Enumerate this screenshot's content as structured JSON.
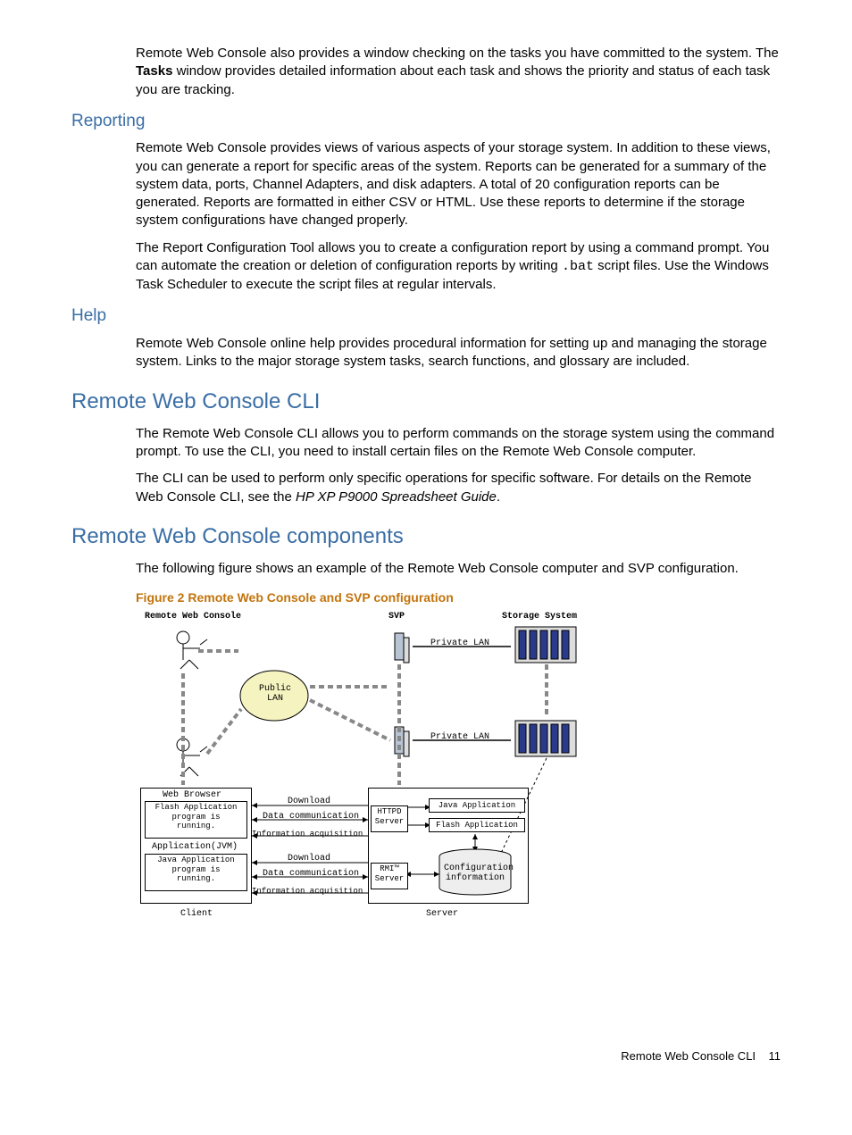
{
  "intro": {
    "p1a": "Remote Web Console also provides a window checking on the tasks you have committed to the system. The ",
    "p1b": "Tasks",
    "p1c": " window provides detailed information about each task and shows the priority and status of each task you are tracking."
  },
  "reporting": {
    "title": "Reporting",
    "p1": "Remote Web Console provides views of various aspects of your storage system. In addition to these views, you can generate a report for specific areas of the system. Reports can be generated for a summary of the system data, ports, Channel Adapters, and disk adapters. A total of 20 configuration reports can be generated. Reports are formatted in either CSV or HTML. Use these reports to determine if the storage system configurations have changed properly.",
    "p2a": "The Report Configuration Tool allows you to create a configuration report by using a command prompt. You can automate the creation or deletion of configuration reports by writing ",
    "p2b": ".bat",
    "p2c": " script files. Use the Windows Task Scheduler to execute the script files at regular intervals."
  },
  "help": {
    "title": "Help",
    "p1": "Remote Web Console online help provides procedural information for setting up and managing the storage system. Links to the major storage system tasks, search functions, and glossary are included."
  },
  "cli": {
    "title": "Remote Web Console CLI",
    "p1": "The Remote Web Console CLI allows you to perform commands on the storage system using the command prompt. To use the CLI, you need to install certain files on the Remote Web Console computer.",
    "p2a": "The CLI can be used to perform only specific operations for specific software. For details on the Remote Web Console CLI, see the ",
    "p2b": "HP XP P9000 Spreadsheet Guide",
    "p2c": "."
  },
  "components": {
    "title": "Remote Web Console components",
    "p1": "The following figure shows an example of the Remote Web Console computer and SVP configuration.",
    "figcap": "Figure 2 Remote Web Console and SVP configuration"
  },
  "diagram": {
    "rwc": "Remote Web Console",
    "svp": "SVP",
    "storage": "Storage System",
    "publiclan": "Public\nLAN",
    "privatelan": "Private LAN",
    "webbrowser": "Web Browser",
    "flashapp": "Flash Application program is running.",
    "appjvm": "Application(JVM)",
    "javaapp": "Java Application program is running.",
    "download": "Download",
    "datacomm": "Data communication",
    "infoacq": "Information acquisition",
    "httpd": "HTTPD Server",
    "rmi": "RMI™ Server",
    "javaappbox": "Java Application",
    "flashappbox": "Flash Application",
    "configinfo": "Configuration information",
    "client": "Client",
    "server": "Server"
  },
  "footer": {
    "text": "Remote Web Console CLI",
    "page": "11"
  }
}
